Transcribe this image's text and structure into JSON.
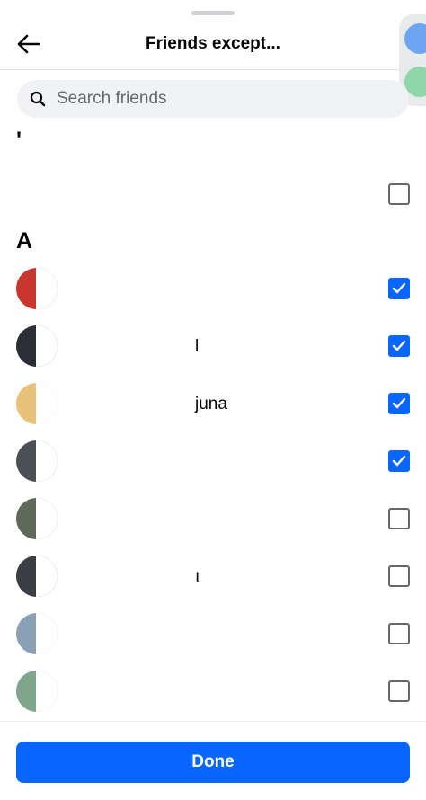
{
  "header": {
    "title": "Friends except..."
  },
  "search": {
    "placeholder": "Search friends"
  },
  "sections": [
    {
      "letter": "'"
    },
    {
      "letter": "A"
    }
  ],
  "friends": [
    {
      "name": "",
      "checked": false,
      "avatar_color": "#ffffff"
    },
    {
      "name": "",
      "checked": true,
      "avatar_color": "#c8372d"
    },
    {
      "name": "l",
      "checked": true,
      "avatar_color": "#2b2e36"
    },
    {
      "name": "juna",
      "checked": true,
      "avatar_color": "#e9c27a"
    },
    {
      "name": "",
      "checked": true,
      "avatar_color": "#4b4f58"
    },
    {
      "name": "",
      "checked": false,
      "avatar_color": "#5d6a5a"
    },
    {
      "name": "ı",
      "checked": false,
      "avatar_color": "#3a3f47"
    },
    {
      "name": "",
      "checked": false,
      "avatar_color": "#8aa0b4"
    },
    {
      "name": "",
      "checked": false,
      "avatar_color": "#7fa58a"
    }
  ],
  "footer": {
    "done_label": "Done"
  },
  "colors": {
    "accent": "#0866ff",
    "search_bg": "#f0f2f5",
    "muted_text": "#65676b"
  },
  "icons": {
    "back": "arrow-left-icon",
    "search": "search-icon",
    "check": "check-icon"
  }
}
